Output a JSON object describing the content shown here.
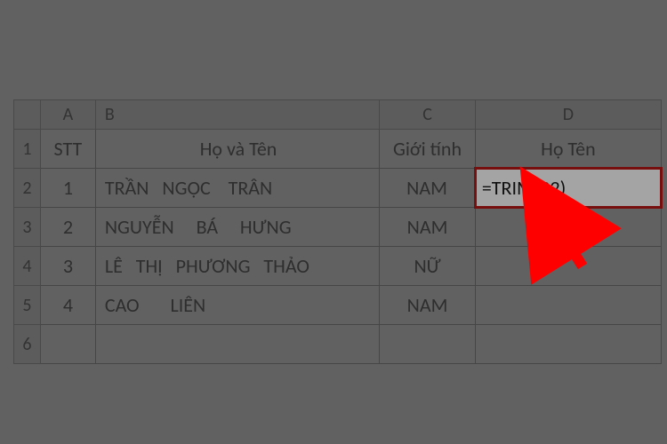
{
  "columns": {
    "A": "A",
    "B": "B",
    "C": "C",
    "D": "D"
  },
  "row_nums": [
    "1",
    "2",
    "3",
    "4",
    "5",
    "6"
  ],
  "headers": {
    "a": "STT",
    "b": "Họ và Tên",
    "c": "Giới tính",
    "d": "Họ Tên"
  },
  "rows": [
    {
      "a": "1",
      "b": "TRẦN   NGỌC    TRÂN",
      "c": "NAM",
      "d": "=TRIM(B2)"
    },
    {
      "a": "2",
      "b": "NGUYỄN     BÁ     HƯNG",
      "c": "NAM",
      "d": ""
    },
    {
      "a": "3",
      "b": "LÊ   THỊ   PHƯƠNG   THẢO",
      "c": "NỮ",
      "d": ""
    },
    {
      "a": "4",
      "b": "CAO       LIÊN",
      "c": "NAM",
      "d": ""
    }
  ],
  "chart_data": {
    "type": "table",
    "title": "",
    "columns": [
      "STT",
      "Họ và Tên",
      "Giới tính",
      "Họ Tên"
    ],
    "rows": [
      [
        "1",
        "TRẦN   NGỌC    TRÂN",
        "NAM",
        "=TRIM(B2)"
      ],
      [
        "2",
        "NGUYỄN     BÁ     HƯNG",
        "NAM",
        ""
      ],
      [
        "3",
        "LÊ   THỊ   PHƯƠNG   THẢO",
        "NỮ",
        ""
      ],
      [
        "4",
        "CAO       LIÊN",
        "NAM",
        ""
      ]
    ]
  }
}
